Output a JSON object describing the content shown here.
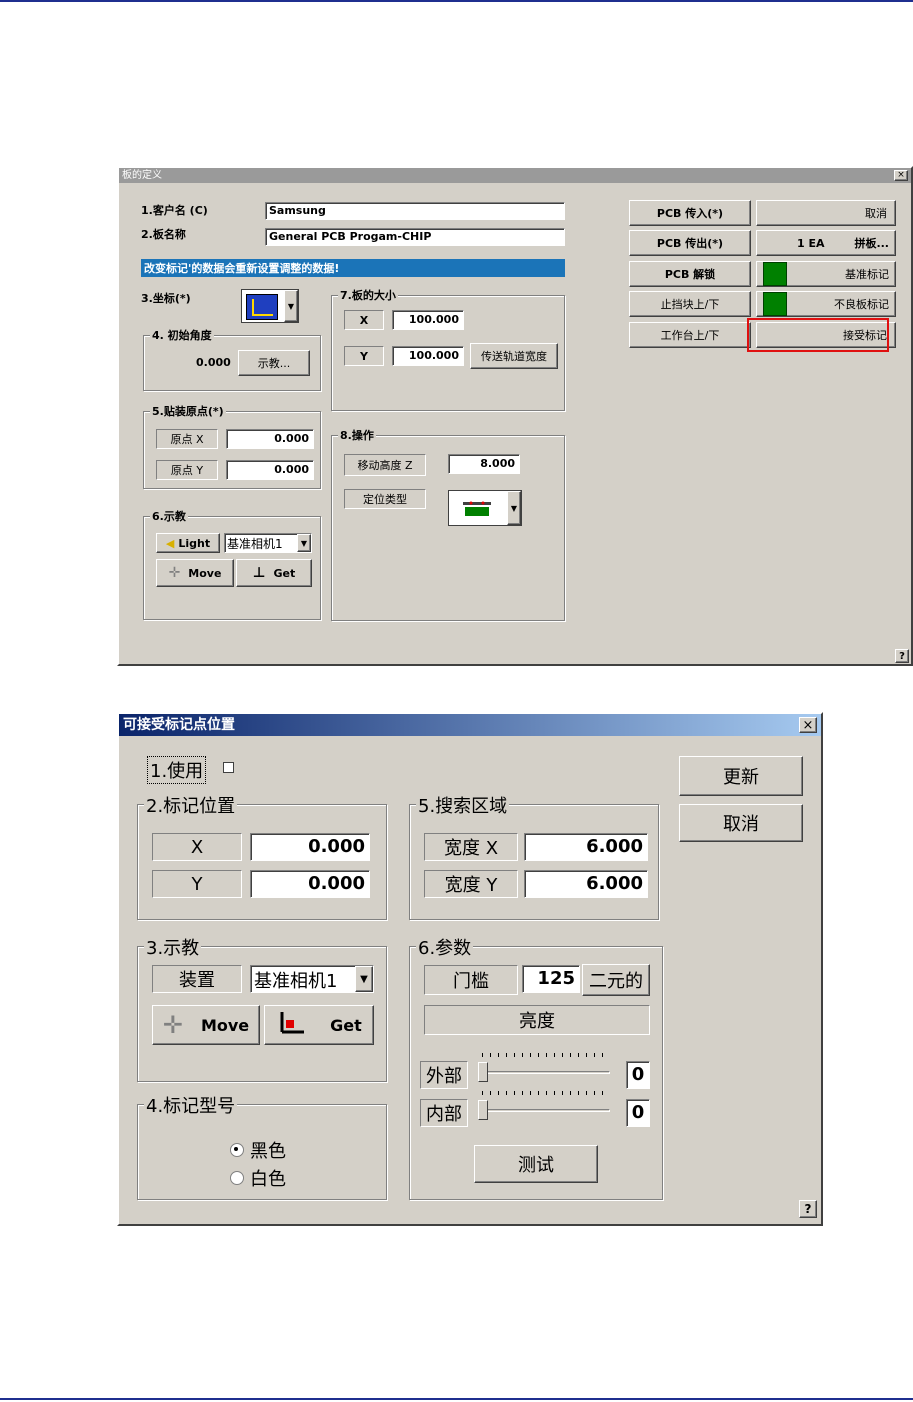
{
  "dialog1": {
    "title": "板的定义",
    "close": "×",
    "customer_label": "1.客户名 (C)",
    "customer_value": "Samsung",
    "board_label": "2.板名称",
    "board_value": "General PCB Progam-CHIP",
    "warning": "改变标记'的数据会重新设置调整的数据!",
    "coord_label": "3.坐标(*)",
    "angle_group": "4. 初始角度",
    "angle_value": "0.000",
    "teach_btn": "示教...",
    "origin_group": "5.贴装原点(*)",
    "origin_x_label": "原点 X",
    "origin_x_value": "0.000",
    "origin_y_label": "原点 Y",
    "origin_y_value": "0.000",
    "teach_group": "6.示教",
    "light_btn": "Light",
    "camera_select": "基准相机1",
    "move_btn": "Move",
    "get_btn": "Get",
    "size_group": "7.板的大小",
    "size_x_label": "X",
    "size_x_value": "100.000",
    "size_y_label": "Y",
    "size_y_value": "100.000",
    "conveyor_btn": "传送轨道宽度",
    "op_group": "8.操作",
    "move_height_label": "移动高度 Z",
    "move_height_value": "8.000",
    "locate_type_label": "定位类型",
    "pcb_in": "PCB 传入(*)",
    "pcb_out": "PCB 传出(*)",
    "pcb_unlock": "PCB 解锁",
    "stopper": "止挡块上/下",
    "table": "工作台上/下",
    "cancel": "取消",
    "panel_count": "1 EA",
    "panel_btn": "拼板...",
    "fiducial": "基准标记",
    "bad_mark": "不良板标记",
    "accept_mark": "接受标记",
    "help": "?"
  },
  "dialog2": {
    "title": "可接受标记点位置",
    "close": "×",
    "use_label": "1.使用",
    "update_btn": "更新",
    "cancel_btn": "取消",
    "pos_group": "2.标记位置",
    "pos_x_label": "X",
    "pos_x_value": "0.000",
    "pos_y_label": "Y",
    "pos_y_value": "0.000",
    "search_group": "5.搜索区域",
    "width_x_label": "宽度 X",
    "width_x_value": "6.000",
    "width_y_label": "宽度 Y",
    "width_y_value": "6.000",
    "teach_group": "3.示教",
    "device_label": "装置",
    "camera_select": "基准相机1",
    "move_btn": "Move",
    "get_btn": "Get",
    "param_group": "6.参数",
    "threshold_label": "门槛",
    "threshold_value": "125",
    "binary_btn": "二元的",
    "brightness_label": "亮度",
    "outer_label": "外部",
    "outer_value": "0",
    "inner_label": "内部",
    "inner_value": "0",
    "test_btn": "测试",
    "marktype_group": "4.标记型号",
    "black": "黑色",
    "white": "白色",
    "help": "?"
  }
}
